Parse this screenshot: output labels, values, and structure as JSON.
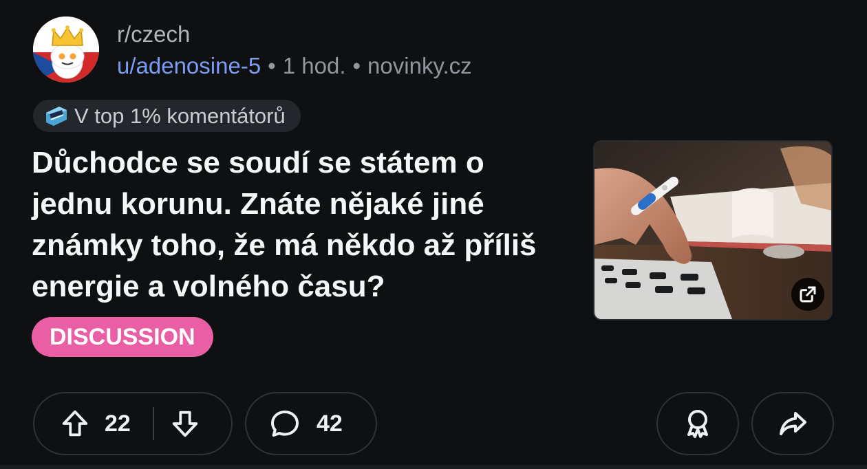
{
  "post": {
    "subreddit": "r/czech",
    "author": "u/adenosine-5",
    "time": "1 hod.",
    "domain": "novinky.cz",
    "separator": "•",
    "badge_label": "V top 1% komentátorů",
    "title": "Důchodce se soudí se státem o jednu korunu. Znáte nějaké jiné známky toho, že má někdo až příliš energie a volného času?",
    "flair": "DISCUSSION",
    "flair_color": "#ea5fa3",
    "thumbnail_icon": "external-link-icon"
  },
  "actions": {
    "upvotes": "22",
    "comments": "42",
    "icons": [
      "upvote-icon",
      "downvote-icon",
      "comment-icon",
      "award-icon",
      "share-icon"
    ]
  },
  "colors": {
    "background": "#0e1012",
    "author_link": "#7b9cf2",
    "muted": "#8e979e"
  }
}
